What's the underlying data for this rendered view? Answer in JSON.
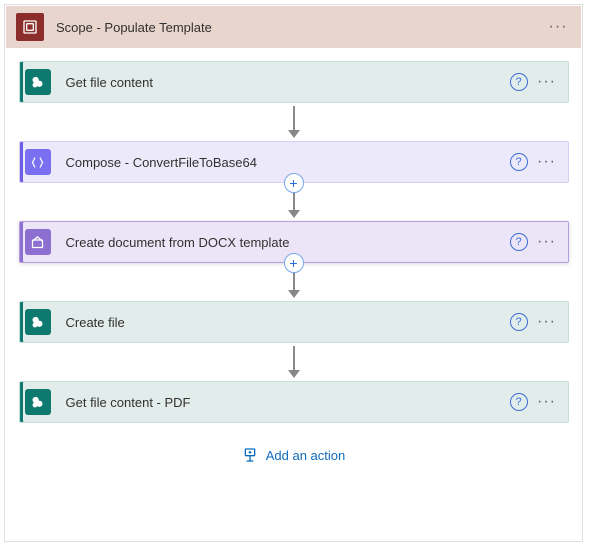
{
  "scope": {
    "title": "Scope - Populate Template"
  },
  "actions": [
    {
      "label": "Get file content",
      "kind": "sharepoint"
    },
    {
      "label": "Compose - ConvertFileToBase64",
      "kind": "compose"
    },
    {
      "label": "Create document from DOCX template",
      "kind": "plumsail"
    },
    {
      "label": "Create file",
      "kind": "sharepoint"
    },
    {
      "label": "Get file content - PDF",
      "kind": "sharepoint"
    }
  ],
  "footer": {
    "add_label": "Add an action"
  },
  "glyphs": {
    "help": "?",
    "more": "···",
    "plus": "+"
  }
}
